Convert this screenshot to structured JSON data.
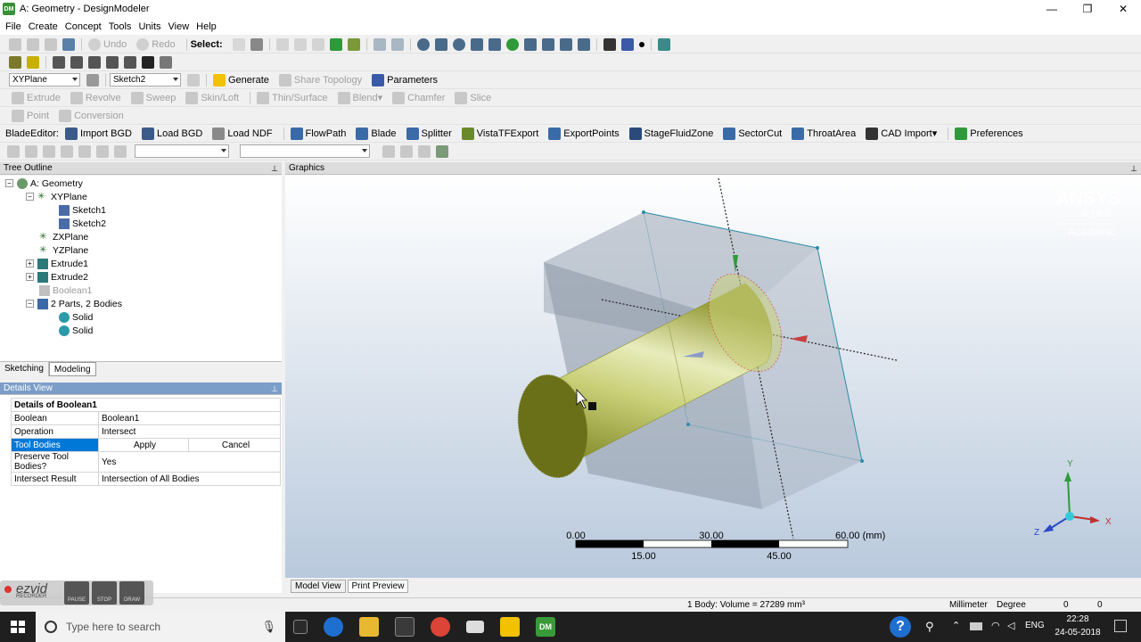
{
  "window": {
    "title": "A: Geometry - DesignModeler",
    "logo": "DM"
  },
  "menu": [
    "File",
    "Create",
    "Concept",
    "Tools",
    "Units",
    "View",
    "Help"
  ],
  "toolbar1": {
    "undo": "Undo",
    "redo": "Redo",
    "select": "Select:"
  },
  "toolbar3": {
    "plane_combo": "XYPlane",
    "sketch_combo": "Sketch2",
    "generate": "Generate",
    "share_topology": "Share Topology",
    "parameters": "Parameters"
  },
  "toolbar4": [
    "Extrude",
    "Revolve",
    "Sweep",
    "Skin/Loft",
    "Thin/Surface",
    "Blend",
    "Chamfer",
    "Slice"
  ],
  "toolbar5": [
    "Point",
    "Conversion"
  ],
  "bladeeditor": {
    "label": "BladeEditor:",
    "items": [
      "Import BGD",
      "Load BGD",
      "Load NDF",
      "FlowPath",
      "Blade",
      "Splitter",
      "VistaTFExport",
      "ExportPoints",
      "StageFluidZone",
      "SectorCut",
      "ThroatArea",
      "CAD Import",
      "Preferences"
    ]
  },
  "tree": {
    "title": "Tree Outline",
    "items": [
      {
        "label": "A: Geometry"
      },
      {
        "label": "XYPlane"
      },
      {
        "label": "Sketch1"
      },
      {
        "label": "Sketch2"
      },
      {
        "label": "ZXPlane"
      },
      {
        "label": "YZPlane"
      },
      {
        "label": "Extrude1"
      },
      {
        "label": "Extrude2"
      },
      {
        "label": "Boolean1"
      },
      {
        "label": "2 Parts, 2 Bodies"
      },
      {
        "label": "Solid"
      },
      {
        "label": "Solid"
      }
    ]
  },
  "tabs": {
    "sketching": "Sketching",
    "modeling": "Modeling"
  },
  "details": {
    "title": "Details View",
    "header": "Details of Boolean1",
    "rows": [
      {
        "label": "Boolean",
        "value": "Boolean1"
      },
      {
        "label": "Operation",
        "value": "Intersect"
      },
      {
        "label": "Tool Bodies",
        "apply": "Apply",
        "cancel": "Cancel"
      },
      {
        "label": "Preserve Tool Bodies?",
        "value": "Yes"
      },
      {
        "label": "Intersect Result",
        "value": "Intersection of All Bodies"
      }
    ]
  },
  "graphics": {
    "title": "Graphics",
    "brand": "ANSYS",
    "version": "R19.0",
    "edition": "Academic",
    "scale": {
      "top": [
        "0.00",
        "30.00",
        "60.00 (mm)"
      ],
      "bottom": [
        "15.00",
        "45.00"
      ]
    },
    "axes": {
      "x": "X",
      "y": "Y",
      "z": "Z"
    }
  },
  "graphics_tabs": {
    "model_view": "Model View",
    "print_preview": "Print Preview"
  },
  "status": {
    "body_info": "1 Body: Volume = 27289 mm³",
    "units": "Millimeter",
    "angle": "Degree",
    "v1": "0",
    "v2": "0"
  },
  "taskbar": {
    "search_placeholder": "Type here to search",
    "lang": "ENG",
    "time": "22:28",
    "date": "24-05-2018",
    "dm": "DM"
  },
  "ezvid": {
    "logo": "ezvid",
    "sub": "RECORDER",
    "pause": "PAUSE",
    "stop": "STOP",
    "draw": "DRAW"
  },
  "colors": {
    "accent": "#0078d7",
    "cylinder": "#a8b040",
    "box": "#9aa6b4",
    "graphics_bg_top": "#ffffff",
    "graphics_bg_bottom": "#b9c9dc"
  }
}
